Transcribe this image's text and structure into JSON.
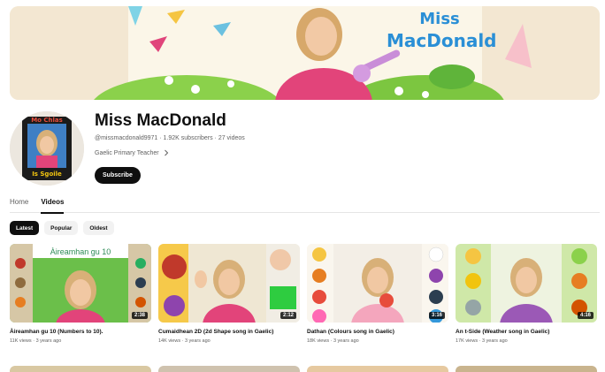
{
  "banner": {
    "title_line1": "Miss",
    "title_line2": "MacDonald"
  },
  "channel": {
    "name": "Miss MacDonald",
    "handle": "@missmacdonald9971",
    "subscribers": "1.92K subscribers",
    "video_count": "27 videos",
    "separator": " · ",
    "description": "Gaelic Primary Teacher",
    "subscribe_label": "Subscribe",
    "avatar_text_top": "Mo Chlas",
    "avatar_text_bottom": "Is Sgoile"
  },
  "tabs": [
    {
      "label": "Home",
      "active": false
    },
    {
      "label": "Videos",
      "active": true
    }
  ],
  "chips": [
    {
      "label": "Latest",
      "active": true
    },
    {
      "label": "Popular",
      "active": false
    },
    {
      "label": "Oldest",
      "active": false
    }
  ],
  "videos": [
    {
      "title": "Àireamhan gu 10 (Numbers to 10).",
      "views": "11K views",
      "age": "3 years ago",
      "duration": "2:38",
      "thumb_text": "Àireamhan gu 10"
    },
    {
      "title": "Cumaidhean 2D (2d Shape song in Gaelic)",
      "views": "14K views",
      "age": "3 years ago",
      "duration": "2:12"
    },
    {
      "title": "Dathan (Colours song in Gaelic)",
      "views": "18K views",
      "age": "3 years ago",
      "duration": "3:16"
    },
    {
      "title": "An t-Side (Weather song in Gaelic)",
      "views": "17K views",
      "age": "3 years ago",
      "duration": "4:16"
    }
  ],
  "colors": {
    "accent": "#0f0f0f",
    "secondary_text": "#606060",
    "banner_title": "#2a8fd6"
  }
}
